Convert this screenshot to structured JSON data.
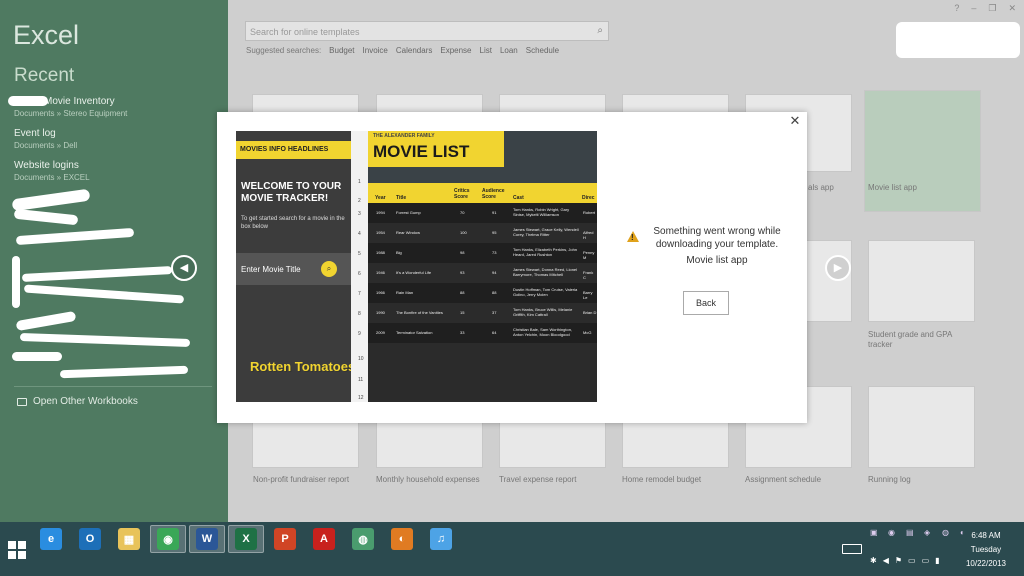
{
  "app": {
    "title": "Excel",
    "recent_heading": "Recent",
    "window_controls": [
      "?",
      "–",
      "❐",
      "✕"
    ]
  },
  "recent": [
    {
      "name": "Movie Inventory",
      "path": "Documents » Stereo Equipment"
    },
    {
      "name": "Event log",
      "path": "Documents » Dell"
    },
    {
      "name": "Website logins",
      "path": "Documents » EXCEL"
    }
  ],
  "open_other": "Open Other Workbooks",
  "search": {
    "placeholder": "Search for online templates",
    "suggested_label": "Suggested searches:",
    "suggestions": [
      "Budget",
      "Invoice",
      "Calendars",
      "Expense",
      "List",
      "Loan",
      "Schedule"
    ]
  },
  "templates": {
    "row1": [
      "als app",
      "Movie list app"
    ],
    "row2": [
      "Student grade and GPA tracker"
    ],
    "row3": [
      "Non-profit fundraiser report",
      "Monthly household expenses",
      "Travel expense report",
      "Home remodel budget",
      "Assignment schedule",
      "Running log"
    ]
  },
  "dialog": {
    "close": "✕",
    "error_message": "Something went wrong while downloading your template.",
    "template_name": "Movie list app",
    "back_label": "Back",
    "nav_prev": "◀",
    "nav_next": "▶"
  },
  "preview": {
    "headlines": "MOVIES  INFO  HEADLINES",
    "welcome": "WELCOME TO YOUR MOVIE TRACKER!",
    "hint": "To get started search for a movie in the box below",
    "entry": "Enter Movie Title",
    "logo": "Rotten Tomatoes",
    "family": "THE ALEXANDER FAMILY",
    "list_title": "MOVIE LIST",
    "headers": [
      "Year",
      "Title",
      "Critics Score",
      "Audience Score",
      "Cast",
      "Direc"
    ],
    "rows": [
      [
        "1994",
        "Forrest Gump",
        "70",
        "91",
        "Tom Hanks, Robin Wright, Gary Sinise, Mykelti Williamson",
        "Robert"
      ],
      [
        "1954",
        "Rear Window",
        "100",
        "95",
        "James Stewart, Grace Kelly, Wendell Corey, Thelma Ritter",
        "Alfred H"
      ],
      [
        "1988",
        "Big",
        "98",
        "73",
        "Tom Hanks, Elizabeth Perkins, John Heard, Jared Rushton",
        "Penny M"
      ],
      [
        "1946",
        "It's a Wonderful Life",
        "93",
        "94",
        "James Stewart, Donna Reed, Lionel Barrymore, Thomas Mitchell",
        "Frank C"
      ],
      [
        "1966",
        "Rain Man",
        "88",
        "88",
        "Dustin Hoffman, Tom Cruise, Valeria Golino, Jerry Molen",
        "Barry Le"
      ],
      [
        "1990",
        "The Bonfire of the Vanities",
        "15",
        "37",
        "Tom Hanks, Bruce Willis, Melanie Griffith, Kim Cattrall",
        "Brian D"
      ],
      [
        "2009",
        "Terminator Salvation",
        "33",
        "64",
        "Christian Bale, Sam Worthington, Anton Yelchin, Moon Bloodgood",
        "McG"
      ]
    ],
    "row_numbers": [
      "1",
      "2",
      "3",
      "4",
      "5",
      "6",
      "7",
      "8",
      "9",
      "10",
      "11",
      "12"
    ]
  },
  "taskbar": {
    "apps": [
      {
        "name": "internet-explorer",
        "glyph": "e",
        "color": "#2a8de0"
      },
      {
        "name": "outlook",
        "glyph": "O",
        "color": "#1d6fb8"
      },
      {
        "name": "file-explorer",
        "glyph": "▦",
        "color": "#e8c35a"
      },
      {
        "name": "chrome",
        "glyph": "◉",
        "color": "#3aa757"
      },
      {
        "name": "word",
        "glyph": "W",
        "color": "#2b5797"
      },
      {
        "name": "excel",
        "glyph": "X",
        "color": "#1e7145"
      },
      {
        "name": "powerpoint",
        "glyph": "P",
        "color": "#d04525"
      },
      {
        "name": "acrobat",
        "glyph": "A",
        "color": "#c8211d"
      },
      {
        "name": "globe",
        "glyph": "◍",
        "color": "#4a9c6e"
      },
      {
        "name": "firefox",
        "glyph": "◐",
        "color": "#e07b22"
      },
      {
        "name": "itunes",
        "glyph": "♫",
        "color": "#4da3e6"
      }
    ],
    "time": "6:48 AM",
    "day": "Tuesday",
    "date": "10/22/2013"
  }
}
